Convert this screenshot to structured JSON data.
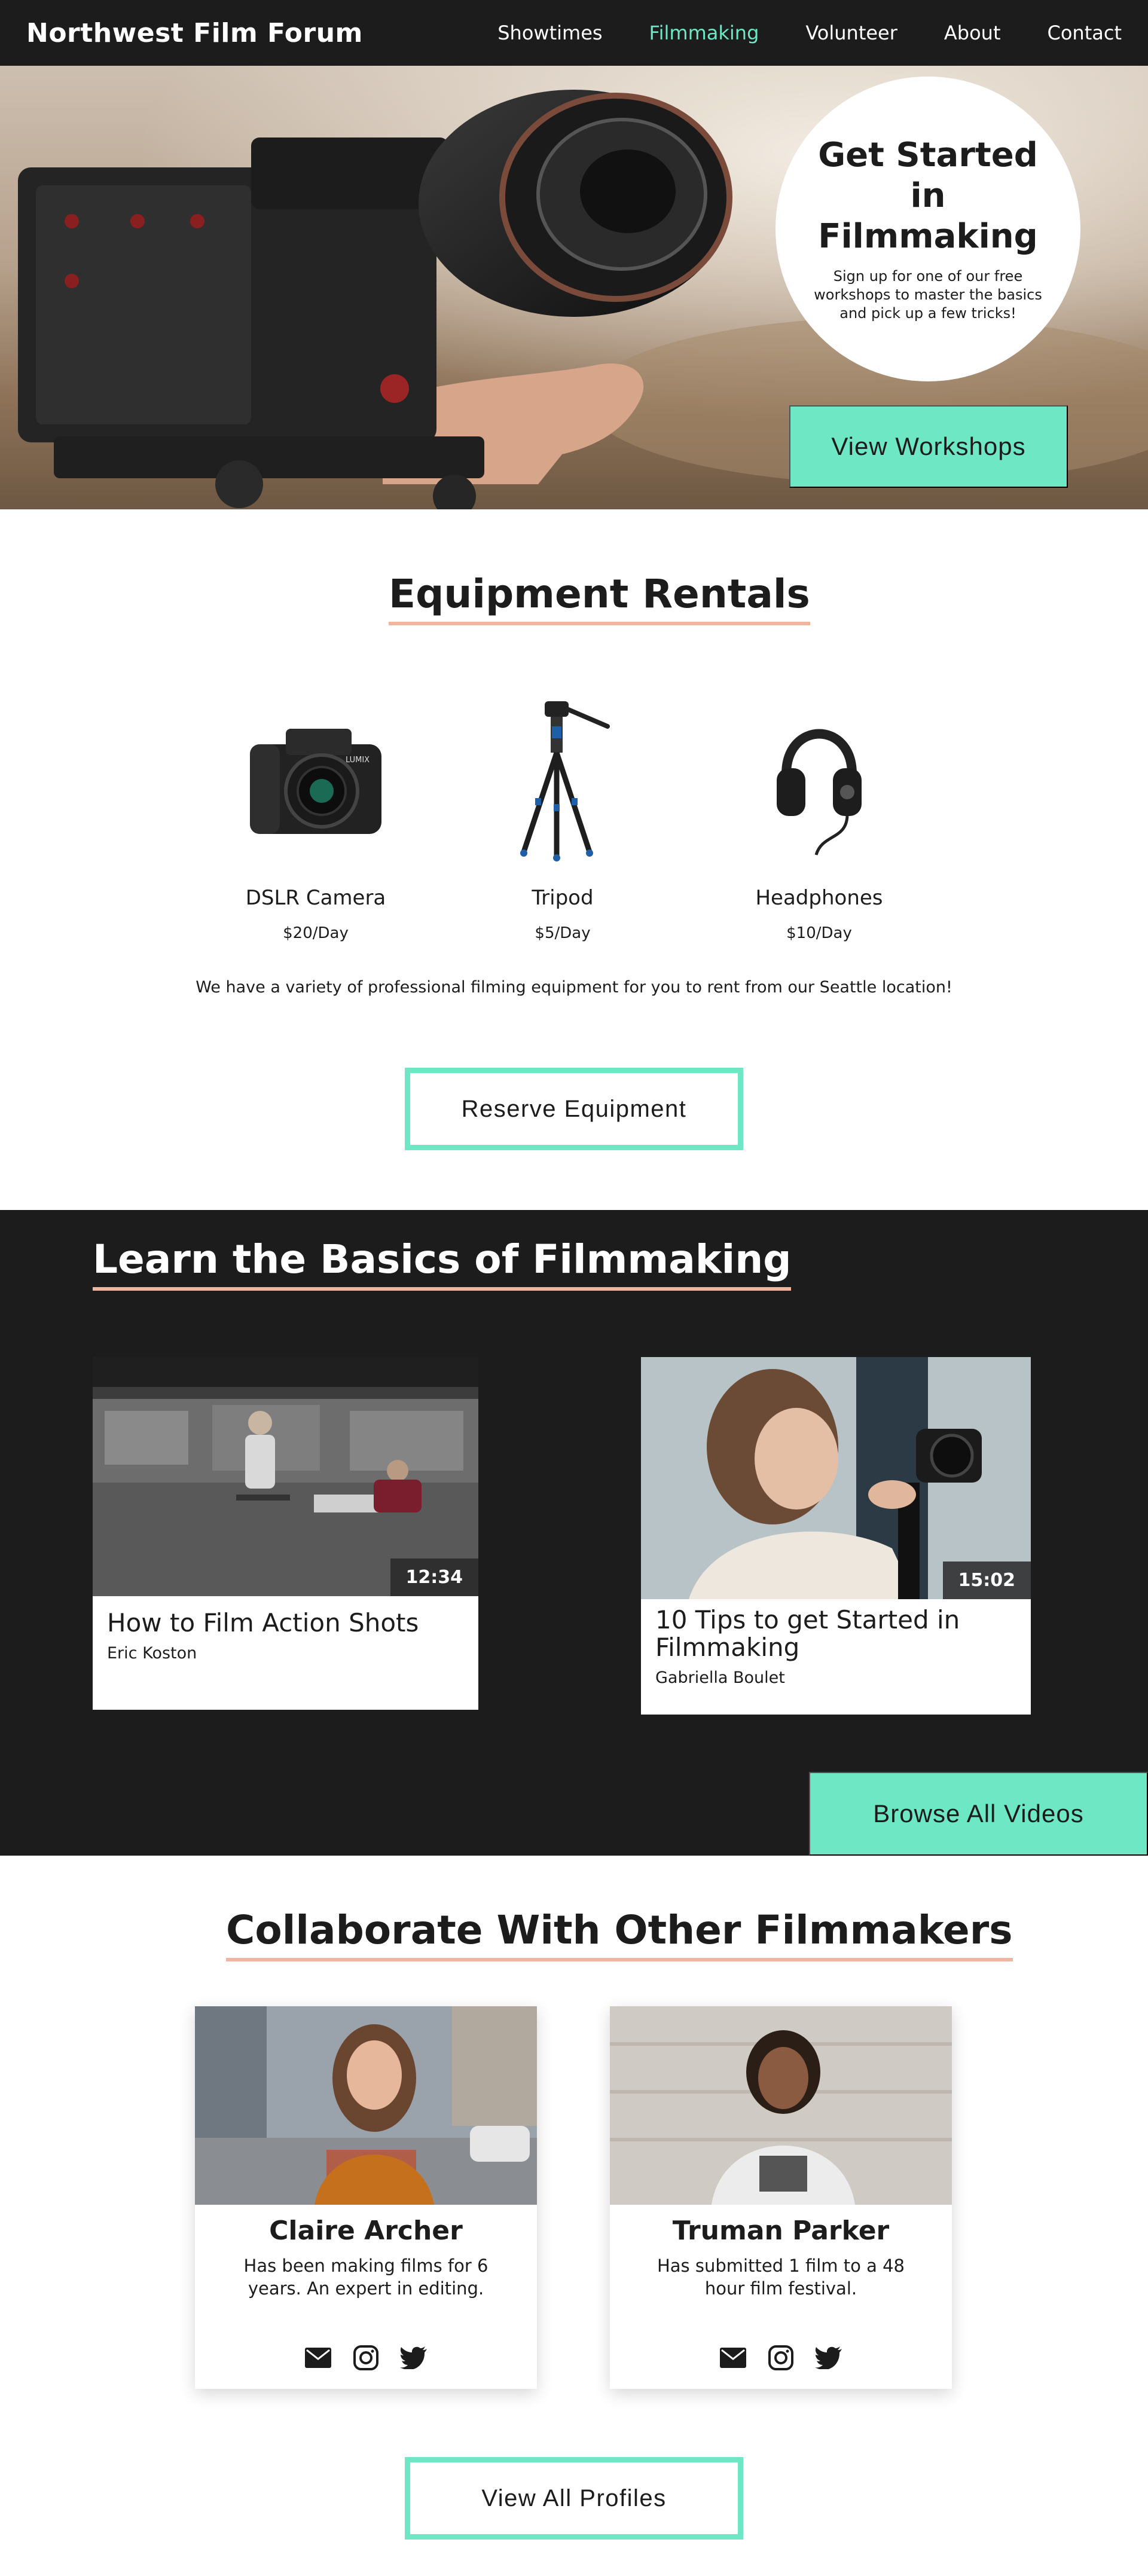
{
  "nav": {
    "brand": "Northwest Film Forum",
    "links": [
      {
        "label": "Showtimes",
        "active": false
      },
      {
        "label": "Filmmaking",
        "active": true
      },
      {
        "label": "Volunteer",
        "active": false
      },
      {
        "label": "About",
        "active": false
      },
      {
        "label": "Contact",
        "active": false
      }
    ]
  },
  "hero": {
    "title": "Get Started in Filmmaking",
    "text": "Sign up for one of our free workshops to master the basics and pick up a few tricks!",
    "button": "View Workshops"
  },
  "rentals": {
    "heading": "Equipment Rentals",
    "items": [
      {
        "name": "DSLR Camera",
        "price": "$20/Day",
        "icon": "camera-icon"
      },
      {
        "name": "Tripod",
        "price": "$5/Day",
        "icon": "tripod-icon"
      },
      {
        "name": "Headphones",
        "price": "$10/Day",
        "icon": "headphones-icon"
      }
    ],
    "camera_brand": "LUMIX",
    "note": "We have a variety of professional filming equipment for you to rent from our Seattle location!",
    "button": "Reserve Equipment"
  },
  "videos": {
    "heading": "Learn the Basics of Filmmaking",
    "items": [
      {
        "title": "How to Film Action Shots",
        "author": "Eric Koston",
        "duration": "12:34"
      },
      {
        "title": "10 Tips to get Started in Filmmaking",
        "author": "Gabriella Boulet",
        "duration": "15:02"
      }
    ],
    "button": "Browse All Videos"
  },
  "profiles": {
    "heading": "Collaborate With Other Filmmakers",
    "items": [
      {
        "name": "Claire Archer",
        "bio": "Has been making films for 6 years. An expert in editing."
      },
      {
        "name": "Truman Parker",
        "bio": "Has submitted 1 film to a 48 hour film festival."
      }
    ],
    "social_icons": [
      "mail-icon",
      "instagram-icon",
      "twitter-icon"
    ],
    "button": "View All Profiles"
  },
  "colors": {
    "accent": "#6ee7c4",
    "underline": "#f0b59f",
    "dark": "#1c1c1c"
  }
}
